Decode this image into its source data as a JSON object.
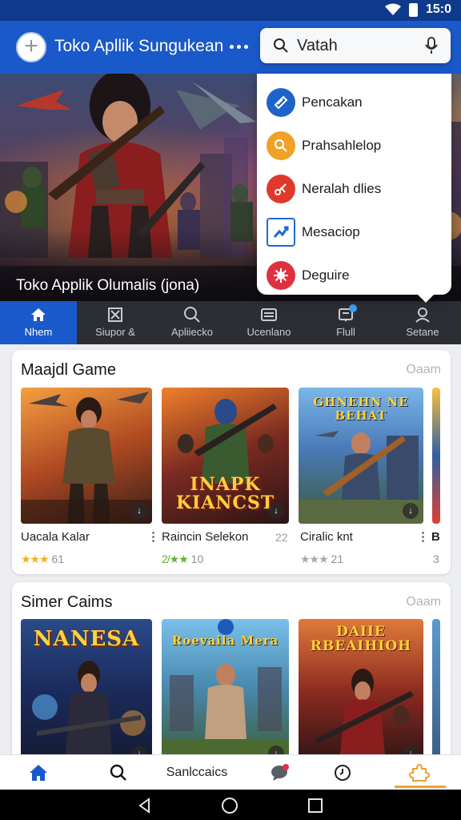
{
  "status_bar": {
    "time": "15:0"
  },
  "app_bar": {
    "title": "Toko Apllik Sungukean"
  },
  "search": {
    "value": "Vatah"
  },
  "hero": {
    "caption": "Toko Applik Olumalis (jona)"
  },
  "tabs": [
    {
      "label": "Nhem",
      "icon": "home-icon",
      "active": true
    },
    {
      "label": "Siupor &",
      "icon": "crossed-box-icon",
      "active": false
    },
    {
      "label": "Apliiecko",
      "icon": "search-icon",
      "active": false
    },
    {
      "label": "Ucenlano",
      "icon": "list-card-icon",
      "active": false
    },
    {
      "label": "Flull",
      "icon": "notification-box-icon",
      "active": false
    },
    {
      "label": "Setane",
      "icon": "person-icon",
      "active": false
    }
  ],
  "menu": {
    "items": [
      {
        "label": "Pencakan",
        "icon": "tag-icon",
        "color": "#1e63c8"
      },
      {
        "label": "Prahsahlelop",
        "icon": "magnifier-icon",
        "color": "#f0a126"
      },
      {
        "label": "Neralah dlies",
        "icon": "scissors-icon",
        "color": "#e0392b"
      },
      {
        "label": "Mesaciop",
        "icon": "chart-arrow-icon",
        "color": "#1e6ad8"
      },
      {
        "label": "Deguire",
        "icon": "gear-burst-icon",
        "color": "#e0303f"
      }
    ]
  },
  "section1": {
    "title": "Maajdl Game",
    "more": "Oaam",
    "games": [
      {
        "name": "Uacala Kalar",
        "rating_stars": "★★★",
        "rating": "61",
        "star_color": "#f2b01e",
        "meta": "",
        "logo": ""
      },
      {
        "name": "Raincin Selekon",
        "rating_stars": "2/★★",
        "rating": "10",
        "star_color": "#62b530",
        "meta": "22",
        "logo": "INAPK KIANCST"
      },
      {
        "name": "Ciralic knt",
        "rating_stars": "★★★",
        "rating": "21",
        "star_color": "#a6a8ad",
        "meta": "",
        "logo": "GHNEHN NE BEHAT"
      },
      {
        "name": "B",
        "rating_stars": "",
        "rating": "3",
        "star_color": "#a6a8ad",
        "meta": "",
        "logo": ""
      }
    ]
  },
  "section2": {
    "title": "Simer Caims",
    "more": "Oaam",
    "games": [
      {
        "logo": "NANESA"
      },
      {
        "logo": "Roevaila Mera"
      },
      {
        "logo": "DAIIE RBEAIHIOH"
      }
    ]
  },
  "bottom_nav": {
    "items": [
      {
        "icon": "home-icon"
      },
      {
        "icon": "search-icon"
      },
      {
        "label": "Sanlccaics"
      },
      {
        "icon": "chat-bubble-icon"
      },
      {
        "icon": "clock-icon"
      },
      {
        "icon": "puzzle-icon"
      }
    ]
  },
  "colors": {
    "brand": "#1a59c9",
    "status_bar": "#0f3a8c",
    "tab_bar": "#2c2e33",
    "accent_underline": "#f0a030"
  }
}
